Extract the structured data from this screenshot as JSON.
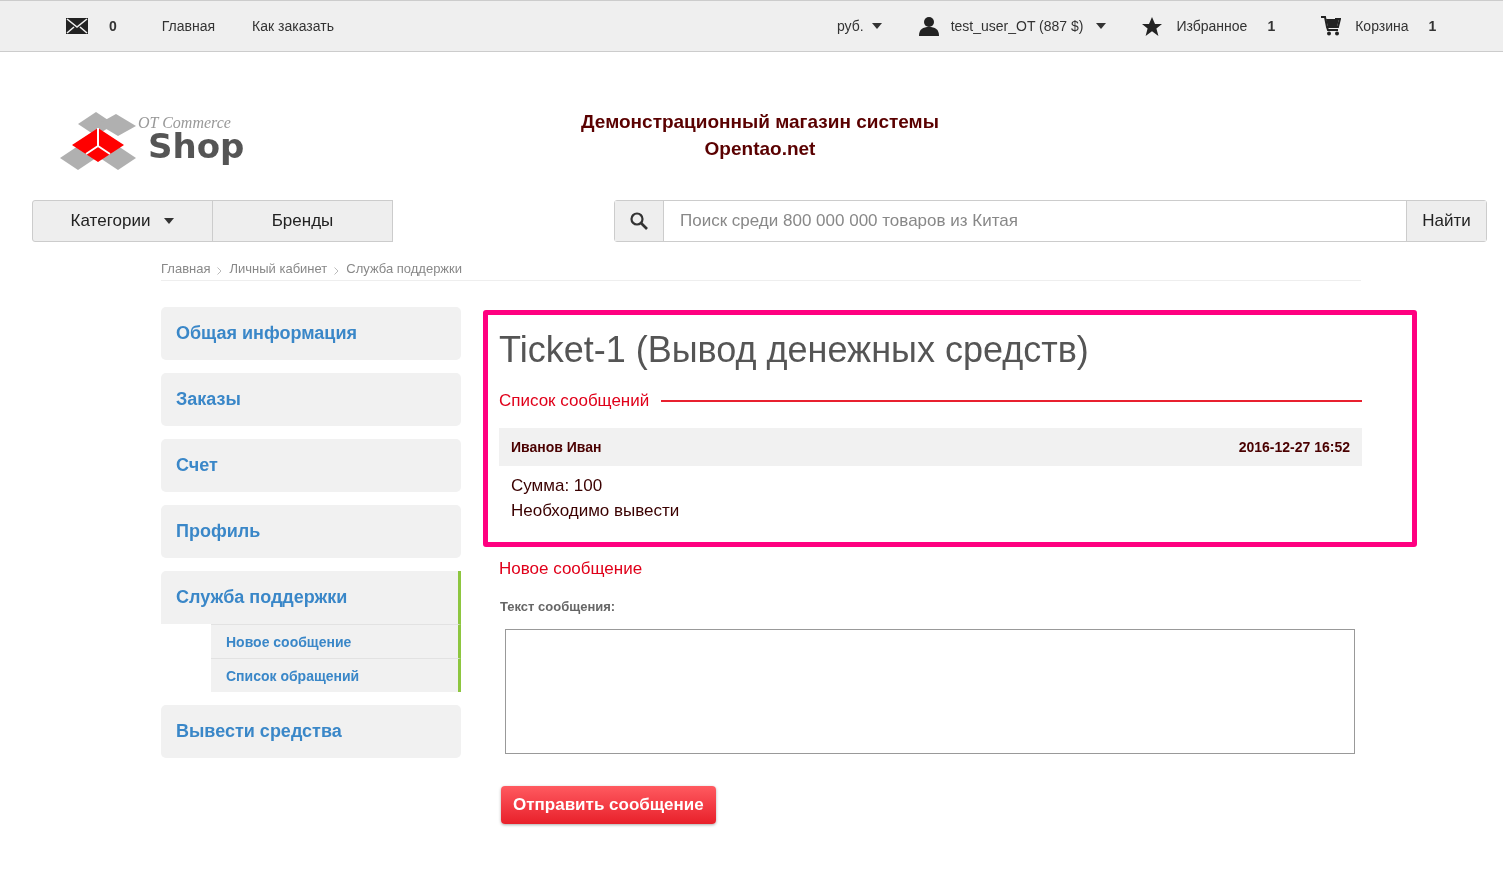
{
  "top_bar": {
    "messages_count": "0",
    "links": [
      "Главная",
      "Как заказать"
    ],
    "currency": "руб.",
    "user": "test_user_OT (887 $)",
    "favorites": {
      "label": "Избранное",
      "count": "1"
    },
    "cart": {
      "label": "Корзина",
      "count": "1"
    }
  },
  "header": {
    "logo": {
      "line1": "OT Commerce",
      "line2": "Shop"
    },
    "title_lines": [
      "Демонстрационный магазин системы",
      "Opentao.net"
    ]
  },
  "nav": {
    "buttons": [
      {
        "label": "Категории",
        "dropdown": true
      },
      {
        "label": "Бренды",
        "dropdown": false
      }
    ],
    "search": {
      "placeholder": "Поиск среди 800 000 000 товаров из Китая",
      "button": "Найти"
    }
  },
  "breadcrumbs": [
    "Главная",
    "Личный кабинет",
    "Служба поддержки"
  ],
  "sidebar": {
    "items": [
      {
        "label": "Общая информация",
        "selected": false
      },
      {
        "label": "Заказы",
        "selected": false
      },
      {
        "label": "Счет",
        "selected": false
      },
      {
        "label": "Профиль",
        "selected": false
      },
      {
        "label": "Служба поддержки",
        "selected": true,
        "children": [
          {
            "label": "Новое сообщение"
          },
          {
            "label": "Список обращений"
          }
        ]
      },
      {
        "label": "Вывести средства",
        "selected": false
      }
    ]
  },
  "ticket": {
    "title": "Ticket-1 (Вывод денежных средств)",
    "messages_heading": "Список сообщений",
    "messages": [
      {
        "author": "Иванов Иван",
        "time": "2016-12-27 16:52",
        "lines": [
          "Сумма: 100",
          "Необходимо вывести"
        ]
      }
    ]
  },
  "new_message": {
    "heading": "Новое сообщение",
    "field_label": "Текст сообщения:",
    "submit": "Отправить сообщение"
  }
}
